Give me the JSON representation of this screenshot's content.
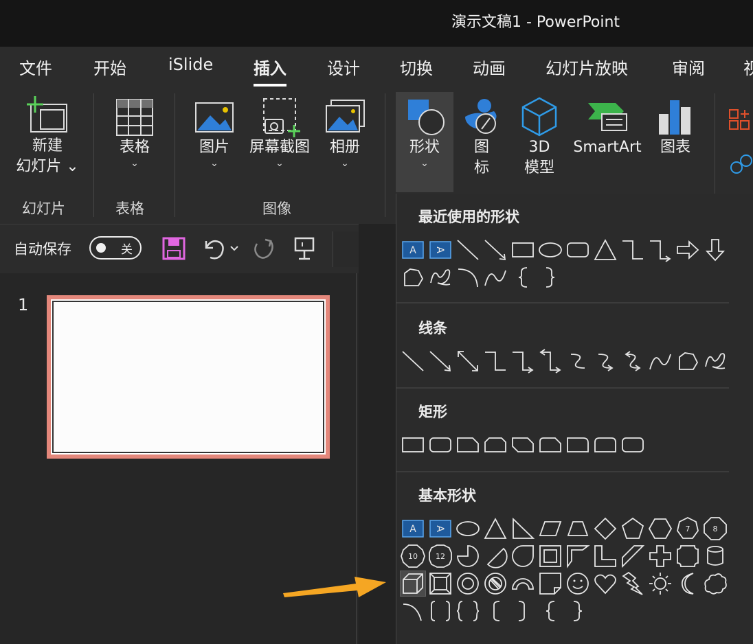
{
  "window": {
    "title": "演示文稿1  -  PowerPoint"
  },
  "tabs": [
    "文件",
    "开始",
    "iSlide",
    "插入",
    "设计",
    "切换",
    "动画",
    "幻灯片放映",
    "审阅",
    "视"
  ],
  "active_tab": "插入",
  "ribbon": {
    "new_slide": {
      "line1": "新建",
      "line2": "幻灯片 ⌄"
    },
    "table": "表格",
    "picture": "图片",
    "screenshot": "屏幕截图",
    "album": "相册",
    "shapes": "形状",
    "icons": {
      "line1": "图",
      "line2": "标"
    },
    "model3d": {
      "line1": "3D",
      "line2": "模型"
    },
    "smartart": "SmartArt",
    "chart": "图表",
    "caret": "⌄",
    "groups": {
      "slides": "幻灯片",
      "tables": "表格",
      "images": "图像"
    }
  },
  "quick_access": {
    "autosave_label": "自动保存",
    "toggle_state": "关"
  },
  "slides_panel": {
    "slide_number": "1"
  },
  "shapes_menu": {
    "sections": [
      "最近使用的形状",
      "线条",
      "矩形",
      "基本形状"
    ]
  },
  "annotation": {
    "arrow_color": "#f5a623"
  },
  "colors": {
    "accent_blue": "#2f7fd8",
    "slide_border": "#e4877b",
    "save_icon": "#e066e0"
  }
}
